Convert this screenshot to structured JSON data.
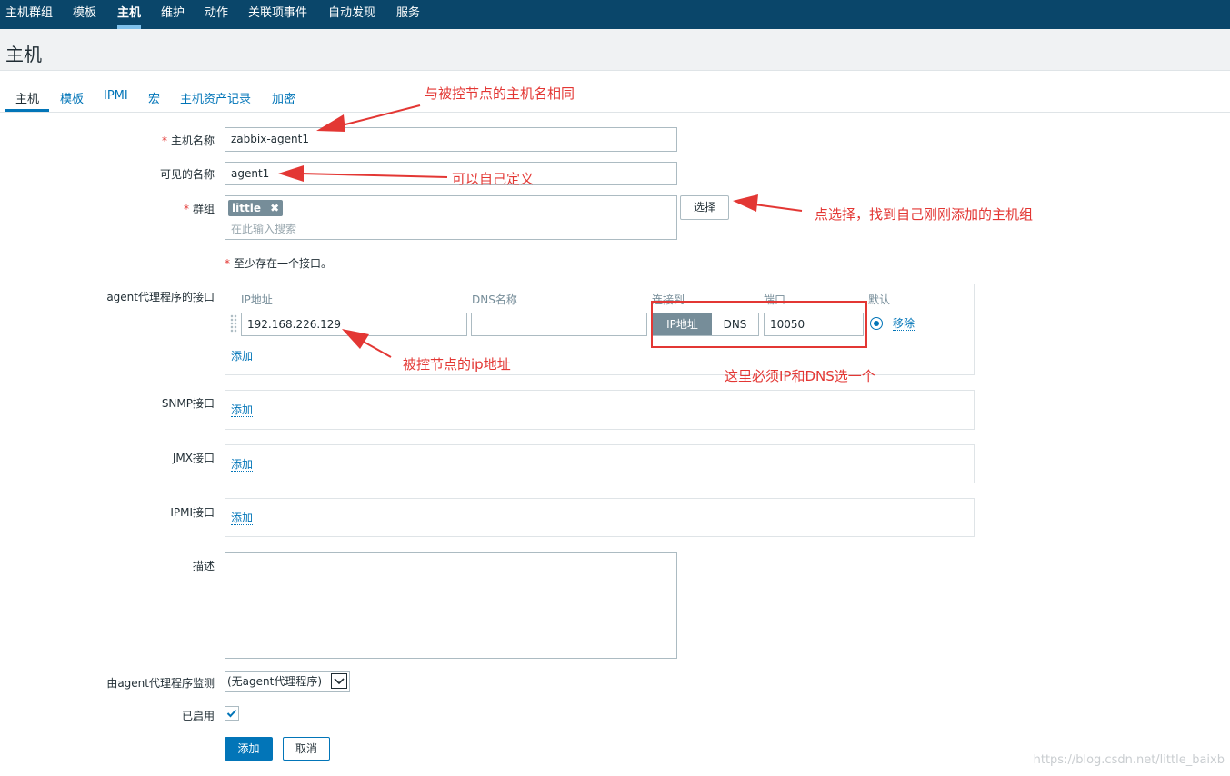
{
  "topnav": {
    "items": [
      "主机群组",
      "模板",
      "主机",
      "维护",
      "动作",
      "关联项事件",
      "自动发现",
      "服务"
    ]
  },
  "page_title": "主机",
  "tabs": [
    "主机",
    "模板",
    "IPMI",
    "宏",
    "主机资产记录",
    "加密"
  ],
  "form": {
    "host_name_label": "主机名称",
    "host_name_value": "zabbix-agent1",
    "visible_name_label": "可见的名称",
    "visible_name_value": "agent1",
    "groups_label": "群组",
    "group_chip": "little",
    "group_chip_remove": "✖",
    "groups_placeholder": "在此输入搜索",
    "select_button": "选择",
    "interface_note": "至少存在一个接口。",
    "agent_label": "agent代理程序的接口",
    "columns": {
      "ip": "IP地址",
      "dns": "DNS名称",
      "connect": "连接到",
      "port": "端口",
      "default": "默认"
    },
    "ip_value": "192.168.226.129",
    "dns_value": "",
    "connect_ip": "IP地址",
    "connect_dns": "DNS",
    "port_value": "10050",
    "remove_link": "移除",
    "add_link": "添加",
    "snmp_label": "SNMP接口",
    "jmx_label": "JMX接口",
    "ipmi_label": "IPMI接口",
    "description_label": "描述",
    "description_value": "",
    "proxy_label": "由agent代理程序监测",
    "proxy_value": "(无agent代理程序)",
    "enabled_label": "已启用",
    "enabled": true,
    "add_button": "添加",
    "cancel_button": "取消"
  },
  "annotations": {
    "host_name": "与被控节点的主机名相同",
    "visible_name": "可以自己定义",
    "select": "点选择，找到自己刚刚添加的主机组",
    "ip": "被控节点的ip地址",
    "connect": "这里必须IP和DNS选一个"
  },
  "watermark": "https://blog.csdn.net/little_baixb",
  "colors": {
    "nav_bg": "#0a466a",
    "link": "#0275b8",
    "annotation": "#e33734"
  }
}
